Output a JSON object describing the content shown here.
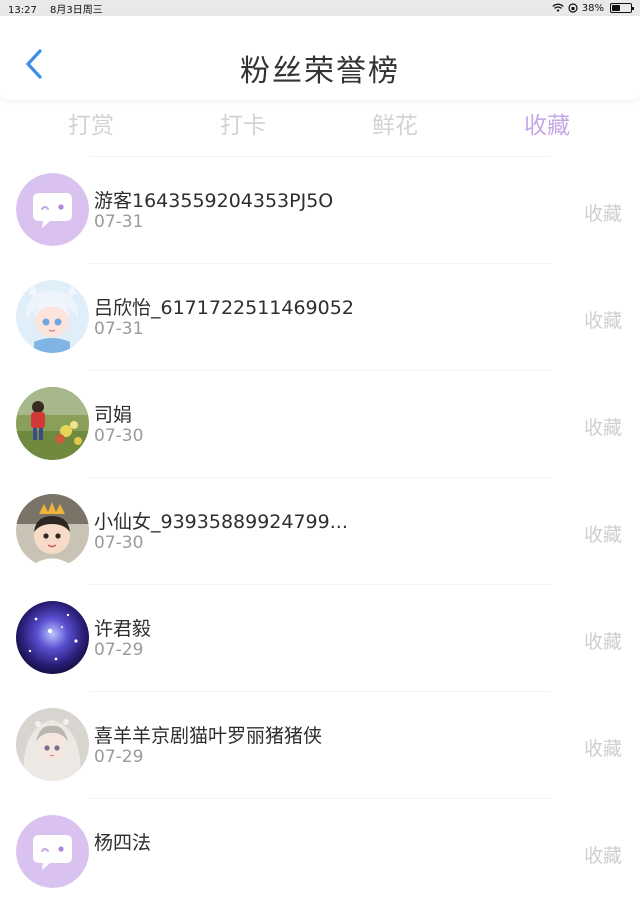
{
  "status_bar": {
    "time": "13:27",
    "date": "8月3日周三",
    "battery": "38%"
  },
  "header": {
    "title": "粉丝荣誉榜"
  },
  "tabs": [
    {
      "label": "打赏",
      "active": false
    },
    {
      "label": "打卡",
      "active": false
    },
    {
      "label": "鲜花",
      "active": false
    },
    {
      "label": "收藏",
      "active": true
    }
  ],
  "colors": {
    "accent": "#c6a8e6",
    "inactive_tab": "#d3d3d6",
    "back": "#3a8ee6"
  },
  "fans": [
    {
      "name": "游客1643559204353PJ5O",
      "date": "07-31",
      "action": "收藏",
      "avatar": "default-chat-avatar"
    },
    {
      "name": "吕欣怡_6171722511469052",
      "date": "07-31",
      "action": "收藏",
      "avatar": "anime-girl-avatar"
    },
    {
      "name": "司娟",
      "date": "07-30",
      "action": "收藏",
      "avatar": "child-garden-avatar"
    },
    {
      "name": "小仙女_93935889924799...",
      "date": "07-30",
      "action": "收藏",
      "avatar": "child-crown-avatar"
    },
    {
      "name": "许君毅",
      "date": "07-29",
      "action": "收藏",
      "avatar": "galaxy-avatar"
    },
    {
      "name": "喜羊羊京剧猫叶罗丽猪猪侠",
      "date": "07-29",
      "action": "收藏",
      "avatar": "anime-fairy-avatar"
    },
    {
      "name": "杨四法",
      "date": "",
      "action": "收藏",
      "avatar": "default-chat-avatar"
    }
  ]
}
